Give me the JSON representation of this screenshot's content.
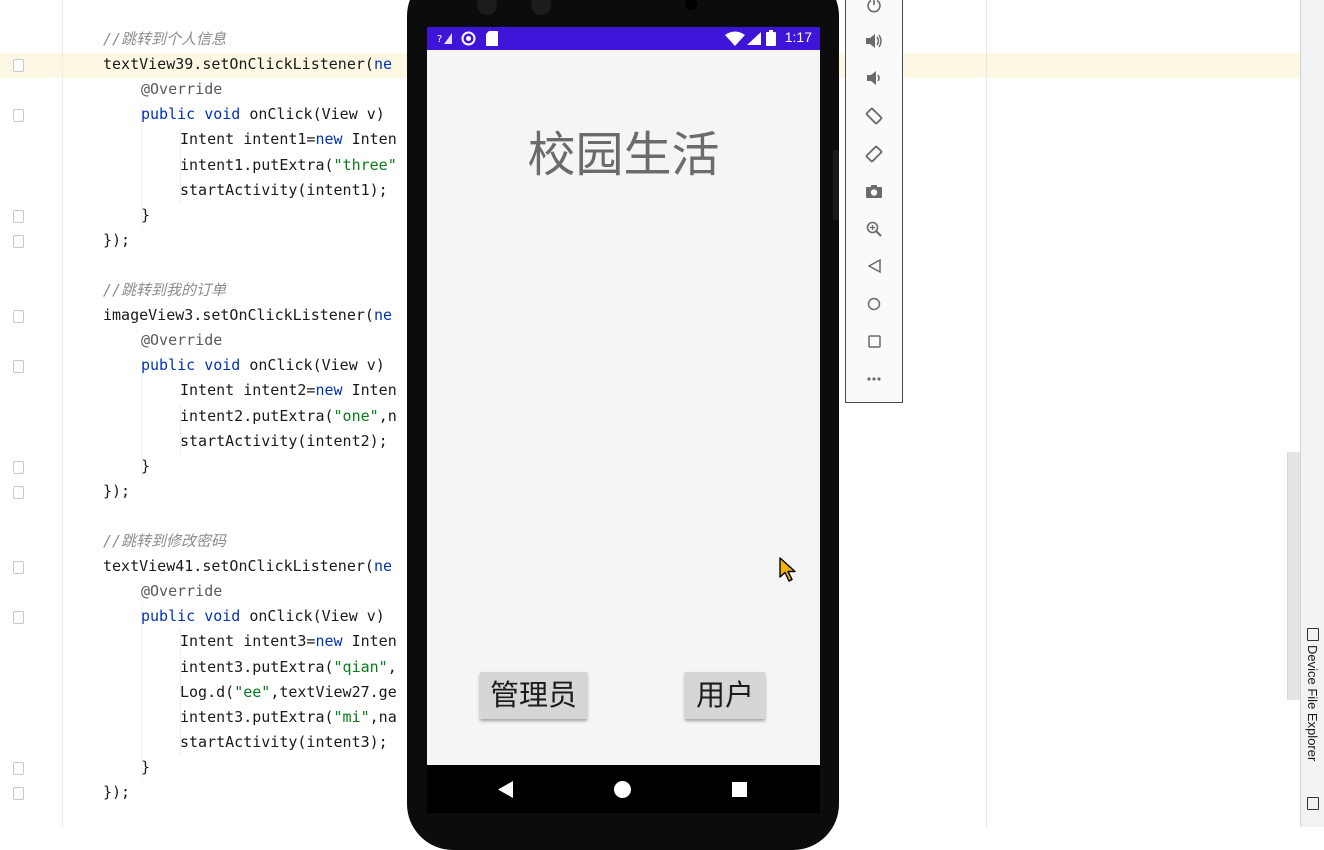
{
  "editor": {
    "lines": [
      {
        "tokens": [
          {
            "c": "cmt",
            "t": "//跳转到个人信息"
          }
        ]
      },
      {
        "tokens": [
          {
            "c": "",
            "t": "textView39.setOnClickListener("
          },
          {
            "c": "kw",
            "t": "ne"
          }
        ]
      },
      {
        "tokens": [
          {
            "c": "ann",
            "t": "@Override"
          }
        ]
      },
      {
        "tokens": [
          {
            "c": "kw",
            "t": "public void "
          },
          {
            "c": "",
            "t": "onClick(View v)"
          }
        ]
      },
      {
        "tokens": [
          {
            "c": "",
            "t": "Intent intent1="
          },
          {
            "c": "kw",
            "t": "new "
          },
          {
            "c": "",
            "t": "Inten"
          }
        ]
      },
      {
        "tokens": [
          {
            "c": "",
            "t": "intent1.putExtra("
          },
          {
            "c": "str",
            "t": "\"three\""
          }
        ]
      },
      {
        "tokens": [
          {
            "c": "",
            "t": "startActivity(intent1);"
          }
        ]
      },
      {
        "tokens": [
          {
            "c": "",
            "t": "}"
          }
        ]
      },
      {
        "tokens": [
          {
            "c": "",
            "t": "});"
          }
        ]
      },
      {
        "tokens": []
      },
      {
        "tokens": [
          {
            "c": "cmt",
            "t": "//跳转到我的订单"
          }
        ]
      },
      {
        "tokens": [
          {
            "c": "",
            "t": "imageView3.setOnClickListener("
          },
          {
            "c": "kw",
            "t": "ne"
          }
        ]
      },
      {
        "tokens": [
          {
            "c": "ann",
            "t": "@Override"
          }
        ]
      },
      {
        "tokens": [
          {
            "c": "kw",
            "t": "public void "
          },
          {
            "c": "",
            "t": "onClick(View v)"
          }
        ]
      },
      {
        "tokens": [
          {
            "c": "",
            "t": "Intent intent2="
          },
          {
            "c": "kw",
            "t": "new "
          },
          {
            "c": "",
            "t": "Inten"
          }
        ]
      },
      {
        "tokens": [
          {
            "c": "",
            "t": "intent2.putExtra("
          },
          {
            "c": "str",
            "t": "\"one\""
          },
          {
            "c": "",
            "t": ",n"
          }
        ]
      },
      {
        "tokens": [
          {
            "c": "",
            "t": "startActivity(intent2);"
          }
        ]
      },
      {
        "tokens": [
          {
            "c": "",
            "t": "}"
          }
        ]
      },
      {
        "tokens": [
          {
            "c": "",
            "t": "});"
          }
        ]
      },
      {
        "tokens": []
      },
      {
        "tokens": [
          {
            "c": "cmt",
            "t": "//跳转到修改密码"
          }
        ]
      },
      {
        "tokens": [
          {
            "c": "",
            "t": "textView41.setOnClickListener("
          },
          {
            "c": "kw",
            "t": "ne"
          }
        ]
      },
      {
        "tokens": [
          {
            "c": "ann",
            "t": "@Override"
          }
        ]
      },
      {
        "tokens": [
          {
            "c": "kw",
            "t": "public void "
          },
          {
            "c": "",
            "t": "onClick(View v)"
          }
        ]
      },
      {
        "tokens": [
          {
            "c": "",
            "t": "Intent intent3="
          },
          {
            "c": "kw",
            "t": "new "
          },
          {
            "c": "",
            "t": "Inten"
          }
        ]
      },
      {
        "tokens": [
          {
            "c": "",
            "t": "intent3.putExtra("
          },
          {
            "c": "str",
            "t": "\"qian\""
          },
          {
            "c": "",
            "t": ","
          }
        ]
      },
      {
        "tokens": [
          {
            "c": "",
            "t": "Log.d("
          },
          {
            "c": "str",
            "t": "\"ee\""
          },
          {
            "c": "",
            "t": ",textView27.ge"
          }
        ]
      },
      {
        "tokens": [
          {
            "c": "",
            "t": "intent3.putExtra("
          },
          {
            "c": "str",
            "t": "\"mi\""
          },
          {
            "c": "",
            "t": ",na"
          }
        ]
      },
      {
        "tokens": [
          {
            "c": "",
            "t": "startActivity(intent3);"
          }
        ]
      },
      {
        "tokens": [
          {
            "c": "",
            "t": "}"
          }
        ]
      },
      {
        "tokens": [
          {
            "c": "",
            "t": "});"
          }
        ]
      }
    ]
  },
  "phone": {
    "status_time": "1:17",
    "app_title": "校园生活",
    "admin_button": "管理员",
    "user_button": "用户"
  },
  "emulator_toolbar": {
    "icons": [
      "power-icon",
      "volume-up-icon",
      "volume-down-icon",
      "rotate-left-icon",
      "rotate-right-icon",
      "screenshot-icon",
      "zoom-icon",
      "back-icon",
      "home-icon",
      "overview-icon",
      "more-icon"
    ]
  },
  "side_panel": {
    "device_file_explorer": "Device File Explorer"
  },
  "colors": {
    "status_bar": "#3f14d9",
    "keyword": "#0033b3",
    "string": "#067d17",
    "comment": "#8c8c8c"
  }
}
